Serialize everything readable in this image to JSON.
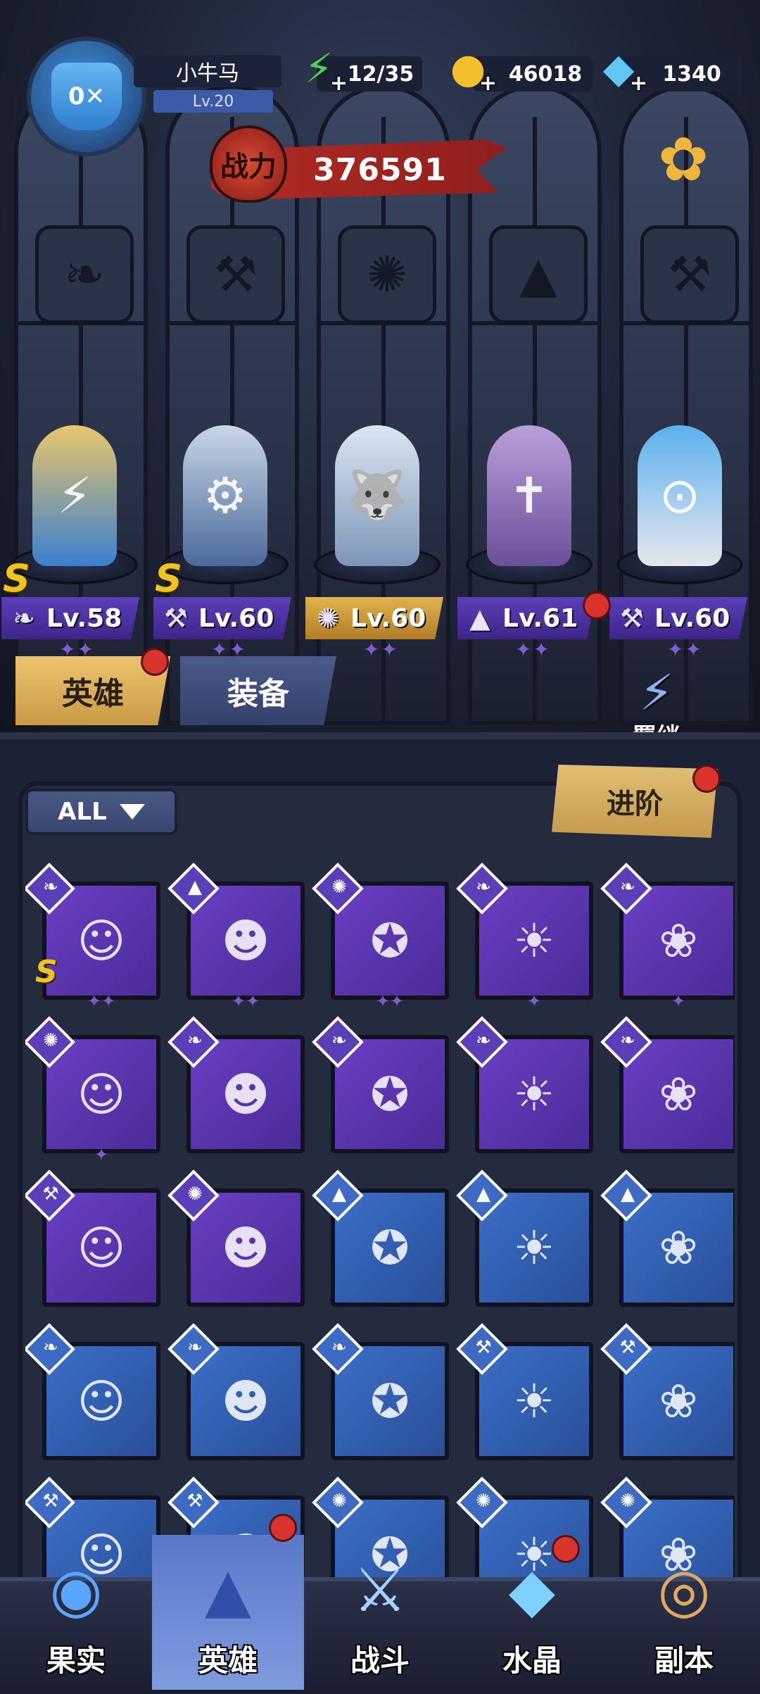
{
  "player": {
    "name": "小牛马",
    "level": "Lv.20"
  },
  "resources": {
    "energy": "12/35",
    "gold": "46018",
    "diamonds": "1340"
  },
  "power": {
    "label": "战力",
    "value": "376591"
  },
  "heroes": [
    {
      "level": "Lv.58",
      "class_icon": "wing-icon",
      "rank": "S",
      "stars": "✦✦"
    },
    {
      "level": "Lv.60",
      "class_icon": "wrench-icon",
      "rank": "S",
      "stars": "✦✦"
    },
    {
      "level": "Lv.60",
      "class_icon": "claw-icon",
      "rank": "",
      "stars": "✦✦"
    },
    {
      "level": "Lv.61",
      "class_icon": "hat-icon",
      "rank": "",
      "stars": "✦✦"
    },
    {
      "level": "Lv.60",
      "class_icon": "wrench-icon",
      "rank": "",
      "stars": "✦✦"
    }
  ],
  "tabs": {
    "heroes": "英雄",
    "equipment": "装备"
  },
  "bond_label": "羁绊",
  "filter_label": "ALL",
  "advance_label": "进阶",
  "roster": [
    {
      "class": "wing",
      "rank": "S",
      "stars": "✦✦"
    },
    {
      "class": "hat",
      "rank": "",
      "stars": "✦✦"
    },
    {
      "class": "claw",
      "rank": "",
      "stars": "✦✦"
    },
    {
      "class": "wing",
      "rank": "",
      "stars": "✦"
    },
    {
      "class": "wing",
      "rank": "",
      "stars": "✦"
    },
    {
      "class": "claw",
      "rank": "",
      "stars": "✦"
    },
    {
      "class": "wing",
      "rank": "",
      "stars": ""
    },
    {
      "class": "wing",
      "rank": "",
      "stars": ""
    },
    {
      "class": "wing",
      "rank": "",
      "stars": ""
    },
    {
      "class": "wing",
      "rank": "",
      "stars": ""
    },
    {
      "class": "wrench",
      "rank": "",
      "stars": ""
    },
    {
      "class": "claw",
      "rank": "",
      "stars": ""
    },
    {
      "class": "hat",
      "rank": "",
      "stars": ""
    },
    {
      "class": "hat",
      "rank": "",
      "stars": ""
    },
    {
      "class": "hat",
      "rank": "",
      "stars": ""
    },
    {
      "class": "wing",
      "rank": "",
      "stars": ""
    },
    {
      "class": "wing",
      "rank": "",
      "stars": ""
    },
    {
      "class": "wing",
      "rank": "",
      "stars": ""
    },
    {
      "class": "wrench",
      "rank": "",
      "stars": ""
    },
    {
      "class": "wrench",
      "rank": "",
      "stars": ""
    },
    {
      "class": "wrench",
      "rank": "",
      "stars": ""
    },
    {
      "class": "wrench",
      "rank": "",
      "stars": ""
    },
    {
      "class": "claw",
      "rank": "",
      "stars": ""
    },
    {
      "class": "claw",
      "rank": "",
      "stars": ""
    },
    {
      "class": "claw",
      "rank": "",
      "stars": ""
    }
  ],
  "nav": {
    "fruit": "果实",
    "heroes": "英雄",
    "battle": "战斗",
    "crystal": "水晶",
    "dungeon": "副本"
  }
}
